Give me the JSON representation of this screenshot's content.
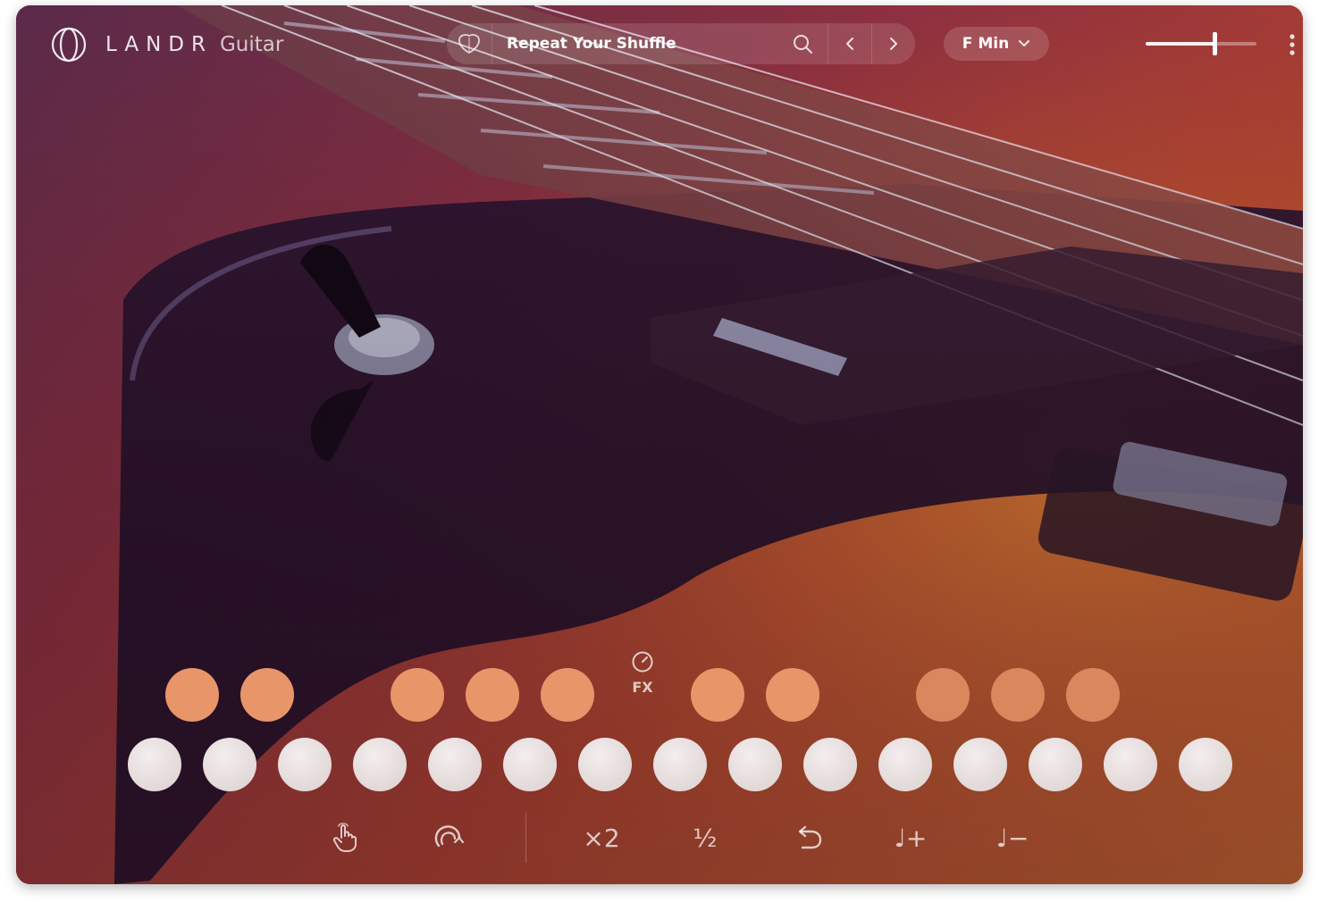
{
  "app": {
    "brand": "LANDR",
    "product": "Guitar"
  },
  "preset_bar": {
    "preset_name": "Repeat Your Shuffle",
    "favorite_icon": "heart-shield-icon",
    "search_icon": "search-icon",
    "prev_icon": "chevron-left-icon",
    "next_icon": "chevron-right-icon"
  },
  "key_selector": {
    "value": "F Min",
    "icon": "chevron-down-icon"
  },
  "volume": {
    "level": 0.62
  },
  "menu": {
    "icon": "more-vertical-icon"
  },
  "pads": {
    "top_row_color": "#e8956a",
    "bottom_row_color": "#e2d8d8",
    "top_row_groups": [
      2,
      3,
      2,
      3
    ],
    "top_row_count": 10,
    "bottom_row_count": 15
  },
  "fx": {
    "label": "FX",
    "icon": "knob-icon"
  },
  "toolbar": {
    "strum_icon": "hand-tap-icon",
    "loop_icon": "rotate-icon",
    "double_label": "×2",
    "half_label": "½",
    "undo_icon": "undo-icon",
    "note_plus_label": "♩+",
    "note_minus_label": "♩−"
  },
  "colors": {
    "accent_orange": "#e8956a",
    "pad_light": "#e2d8d8",
    "text": "#ffffff"
  }
}
